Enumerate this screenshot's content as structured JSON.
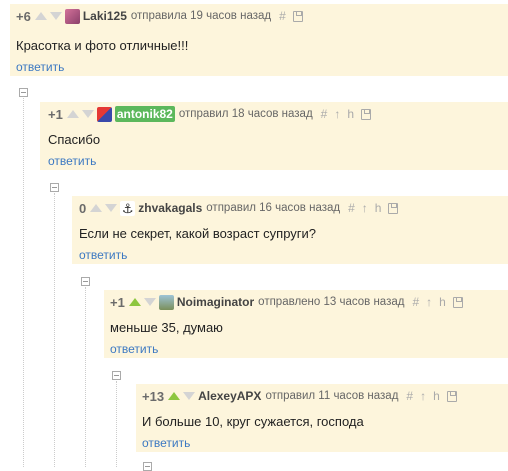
{
  "comments": [
    {
      "rating": "+6",
      "author": "Laki125",
      "meta": "отправила 19 часов назад",
      "text": "Красотка и фото отличные!!!",
      "reply": "ответить"
    },
    {
      "rating": "+1",
      "author": "antonik82",
      "meta": "отправил 18 часов назад",
      "text": "Спасибо",
      "reply": "ответить"
    },
    {
      "rating": "0",
      "author": "zhvakagals",
      "meta": "отправил 16 часов назад",
      "text": "Если не секрет, какой возраст супруги?",
      "reply": "ответить"
    },
    {
      "rating": "+1",
      "author": "Noimaginator",
      "meta": "отправлено 13 часов назад",
      "text": "меньше 35, думаю",
      "reply": "ответить"
    },
    {
      "rating": "+13",
      "author": "AlexeyAPX",
      "meta": "отправил 11 часов назад",
      "text": "И больше 10, круг сужается, господа",
      "reply": "ответить"
    }
  ],
  "icons": {
    "permalink": "#",
    "up": "↑",
    "thread": "h"
  },
  "colors": {
    "accent": "#3b78c2",
    "bg": "#fdf5dc",
    "upvote": "#8dc63f",
    "badge": "#5cb85c"
  }
}
